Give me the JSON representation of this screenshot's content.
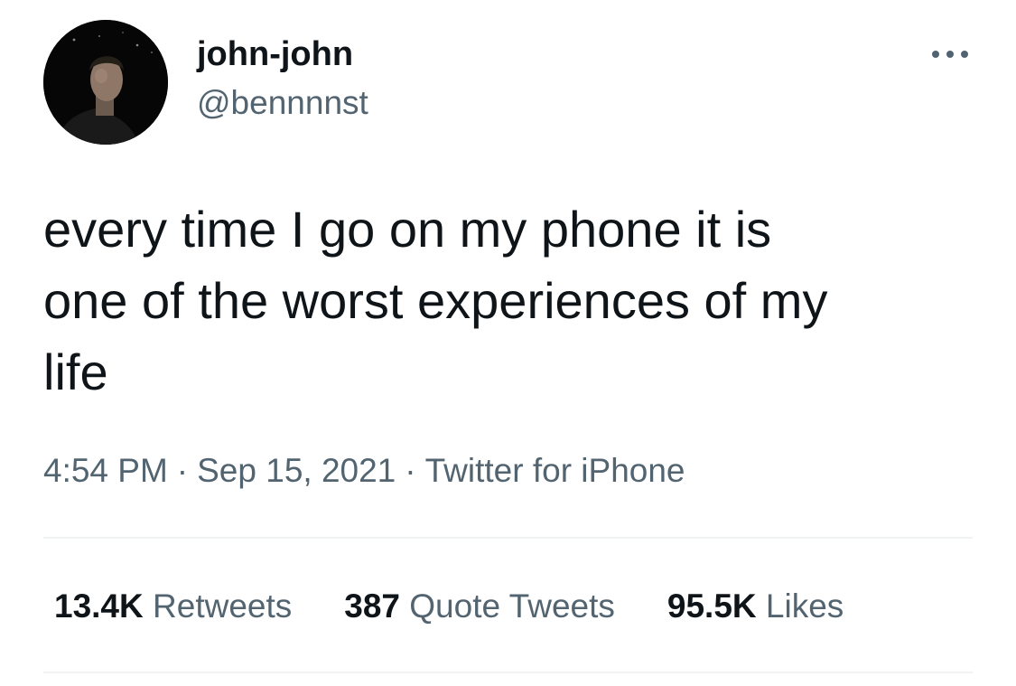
{
  "author": {
    "display_name": "john-john",
    "handle": "@bennnnst"
  },
  "tweet": {
    "text": "every time I go on my phone it is\none of the worst experiences of my\nlife"
  },
  "meta": {
    "time": "4:54 PM",
    "separator": "·",
    "date": "Sep 15, 2021",
    "source": "Twitter for iPhone"
  },
  "stats": {
    "retweets": {
      "count": "13.4K",
      "label": "Retweets"
    },
    "quotes": {
      "count": "387",
      "label": "Quote Tweets"
    },
    "likes": {
      "count": "95.5K",
      "label": "Likes"
    }
  },
  "icons": {
    "more": "more-horizontal-icon"
  },
  "colors": {
    "text_primary": "#0f1419",
    "text_secondary": "#536471",
    "divider": "#eff3f4",
    "background": "#ffffff"
  }
}
